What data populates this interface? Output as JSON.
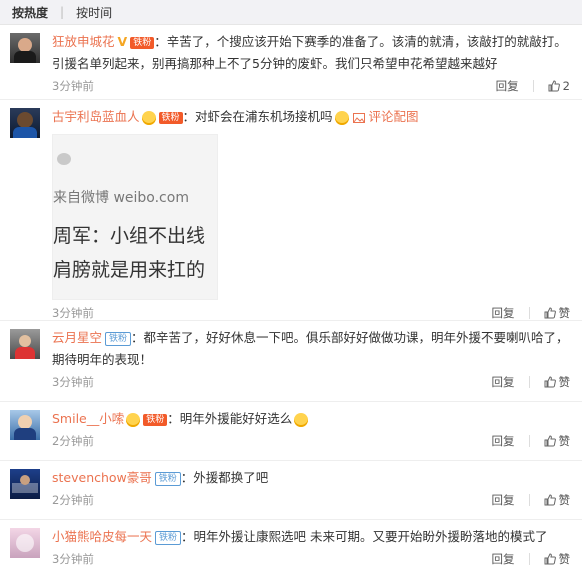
{
  "tabs": [
    "按热度",
    "按时间"
  ],
  "comments": [
    {
      "user": "狂放申城花",
      "badge": "铁粉",
      "text": "：辛苦了，个搜应该开始下赛季的准备了。该清的就清，该敲打的就敲打。引援名单列起来，别再搞那种上不了5分钟的废虾。我们只希望申花希望越来越好",
      "time": "3分钟前",
      "reply": "回复",
      "likes": "2"
    },
    {
      "user": "古宇利岛蓝血人",
      "badge": "铁粉",
      "text": "：对虾会在浦东机场接机吗",
      "image_link": "评论配图",
      "image_lines": [
        "来自微博 weibo.com",
        "周军：小组不出线",
        "肩膀就是用来扛的"
      ],
      "time": "3分钟前",
      "reply": "回复",
      "like_label": "赞"
    },
    {
      "user": "云月星空",
      "badge": "铁粉",
      "text": "：都辛苦了，好好休息一下吧。俱乐部好好做做功课，明年外援不要喇叭哈了，期待明年的表现！",
      "time": "3分钟前",
      "reply": "回复",
      "like_label": "赞"
    },
    {
      "user": "Smile__小嗦",
      "badge": "铁粉",
      "text": "：明年外援能好好选么",
      "time": "2分钟前",
      "reply": "回复",
      "like_label": "赞"
    },
    {
      "user": "stevenchow豪哥",
      "badge": "铁粉",
      "text": "：外援都换了吧",
      "time": "2分钟前",
      "reply": "回复",
      "like_label": "赞"
    },
    {
      "user": "小猫熊哈皮每一天",
      "badge": "铁粉",
      "text": "：明年外援让康熙选吧 未来可期。又要开始盼外援盼落地的模式了",
      "time": "3分钟前",
      "reply": "回复",
      "like_label": "赞"
    }
  ]
}
